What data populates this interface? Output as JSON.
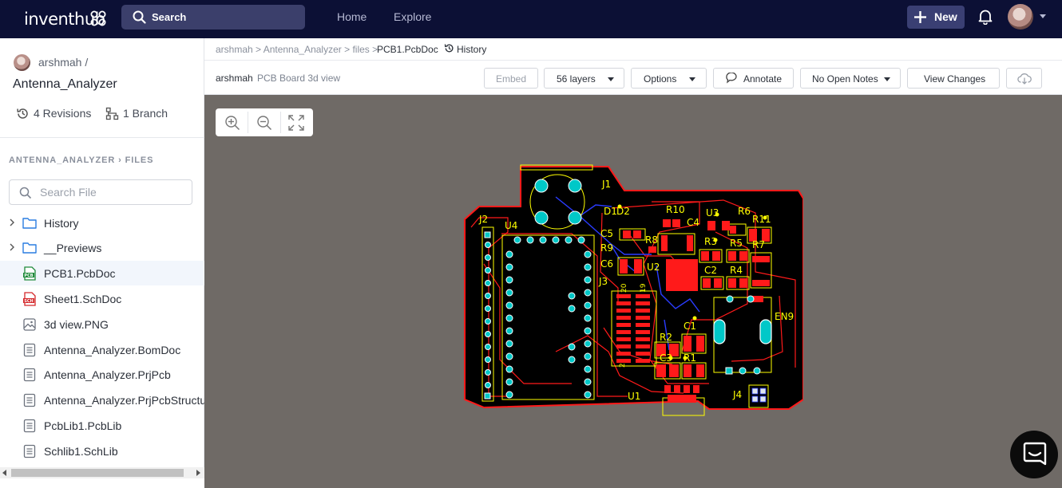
{
  "topbar": {
    "logo": "inventhub",
    "search_label": "Search",
    "nav": [
      "Home",
      "Explore"
    ],
    "new_label": "New",
    "icons": {
      "search": "search-icon",
      "new": "plus-icon",
      "notifications": "bell-icon"
    }
  },
  "sidebar": {
    "owner": "arshmah /",
    "repo": "Antenna_Analyzer",
    "revisions": "4 Revisions",
    "branches": "1 Branch",
    "files_crumb": "ANTENNA_ANALYZER › FILES",
    "search_placeholder": "Search File",
    "items": [
      {
        "label": "History",
        "type": "folder",
        "expandable": true
      },
      {
        "label": "__Previews",
        "type": "folder",
        "expandable": true
      },
      {
        "label": "PCB1.PcbDoc",
        "type": "pcb",
        "selected": true
      },
      {
        "label": "Sheet1.SchDoc",
        "type": "sch"
      },
      {
        "label": "3d view.PNG",
        "type": "image"
      },
      {
        "label": "Antenna_Analyzer.BomDoc",
        "type": "doc"
      },
      {
        "label": "Antenna_Analyzer.PrjPcb",
        "type": "doc"
      },
      {
        "label": "Antenna_Analyzer.PrjPcbStructure",
        "type": "doc"
      },
      {
        "label": "PcbLib1.PcbLib",
        "type": "doc"
      },
      {
        "label": "Schlib1.SchLib",
        "type": "doc"
      }
    ]
  },
  "breadcrumb": {
    "path": "arshmah > Antenna_Analyzer > files >",
    "current": "PCB1.PcbDoc",
    "history": "History"
  },
  "toolbar": {
    "owner": "arshmah",
    "view": "PCB Board 3d view",
    "embed": "Embed",
    "layers": "56 layers",
    "options": "Options",
    "annotate": "Annotate",
    "notes": "No Open Notes",
    "view_changes": "View Changes"
  },
  "pcb": {
    "labels": [
      "J1",
      "J2",
      "U4",
      "D1",
      "D2",
      "R10",
      "U3",
      "R6",
      "R11",
      "C5",
      "R8",
      "C4",
      "R3",
      "R5",
      "R9",
      "R7",
      "C6",
      "U2",
      "C2",
      "R4",
      "J3",
      "20",
      "19",
      "EN9",
      "C1",
      "R2",
      "C3",
      "R1",
      "U1",
      "J4",
      "2"
    ],
    "colors": {
      "board": "#000000",
      "outline": "#ff0000",
      "copper": "#ff1a1a",
      "silk": "#ffff00",
      "pad": "#00c8c8",
      "trace_blue": "#2a3cff",
      "canvas": "#6f6a66"
    }
  },
  "colors": {
    "topbar": "#0c1035",
    "search_bg": "#3b3f6b",
    "new_bg": "#3a3f73",
    "selected_row": "#f2f6fc"
  }
}
